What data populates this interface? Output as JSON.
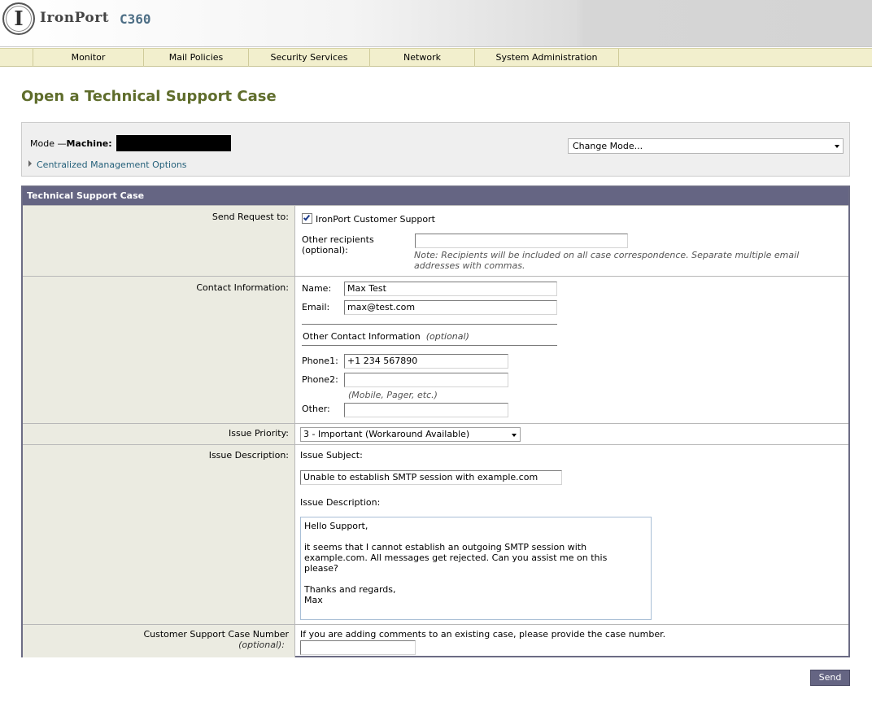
{
  "header": {
    "logo_letter": "I",
    "brand": "IronPort",
    "product": "C360"
  },
  "nav": {
    "items": [
      "Monitor",
      "Mail Policies",
      "Security Services",
      "Network",
      "System Administration"
    ]
  },
  "page": {
    "title": "Open a Technical Support Case"
  },
  "mode": {
    "label_prefix": "Mode —",
    "label_machine": "Machine:",
    "change_mode_select": "Change Mode...",
    "centralized_link": "Centralized Management Options"
  },
  "case": {
    "header": "Technical Support Case",
    "send_request": {
      "label": "Send Request to:",
      "checkbox_label": "IronPort Customer Support",
      "checked": true,
      "other_recipients_label_1": "Other recipients",
      "other_recipients_label_2": "(optional):",
      "other_recipients_value": "",
      "note_line_1": "Note: Recipients will be included on all case correspondence. Separate multiple email",
      "note_line_2": "addresses with commas."
    },
    "contact": {
      "label": "Contact Information:",
      "name_label": "Name:",
      "name_value": "Max Test",
      "email_label": "Email:",
      "email_value": "max@test.com",
      "other_contact_label": "Other Contact Information",
      "optional": "(optional)",
      "phone1_label": "Phone1:",
      "phone1_value": "+1 234 567890",
      "phone2_label": "Phone2:",
      "phone2_value": "",
      "phone2_hint": "(Mobile, Pager, etc.)",
      "other_label": "Other:",
      "other_value": ""
    },
    "priority": {
      "label": "Issue Priority:",
      "selected": "3 - Important (Workaround Available)"
    },
    "description": {
      "label": "Issue Description:",
      "subject_label": "Issue Subject:",
      "subject_value": "Unable to establish SMTP session with example.com",
      "desc_label": "Issue Description:",
      "desc_value": "Hello Support,\n\nit seems that I cannot establish an outgoing SMTP session with\nexample.com. All messages get rejected. Can you assist me on this\nplease?\n\nThanks and regards,\nMax"
    },
    "case_number": {
      "label": "Customer Support Case Number",
      "label_sub": "(optional):",
      "hint": "If you are adding comments to an existing case, please provide the case number.",
      "value": ""
    }
  },
  "actions": {
    "send_label": "Send"
  }
}
